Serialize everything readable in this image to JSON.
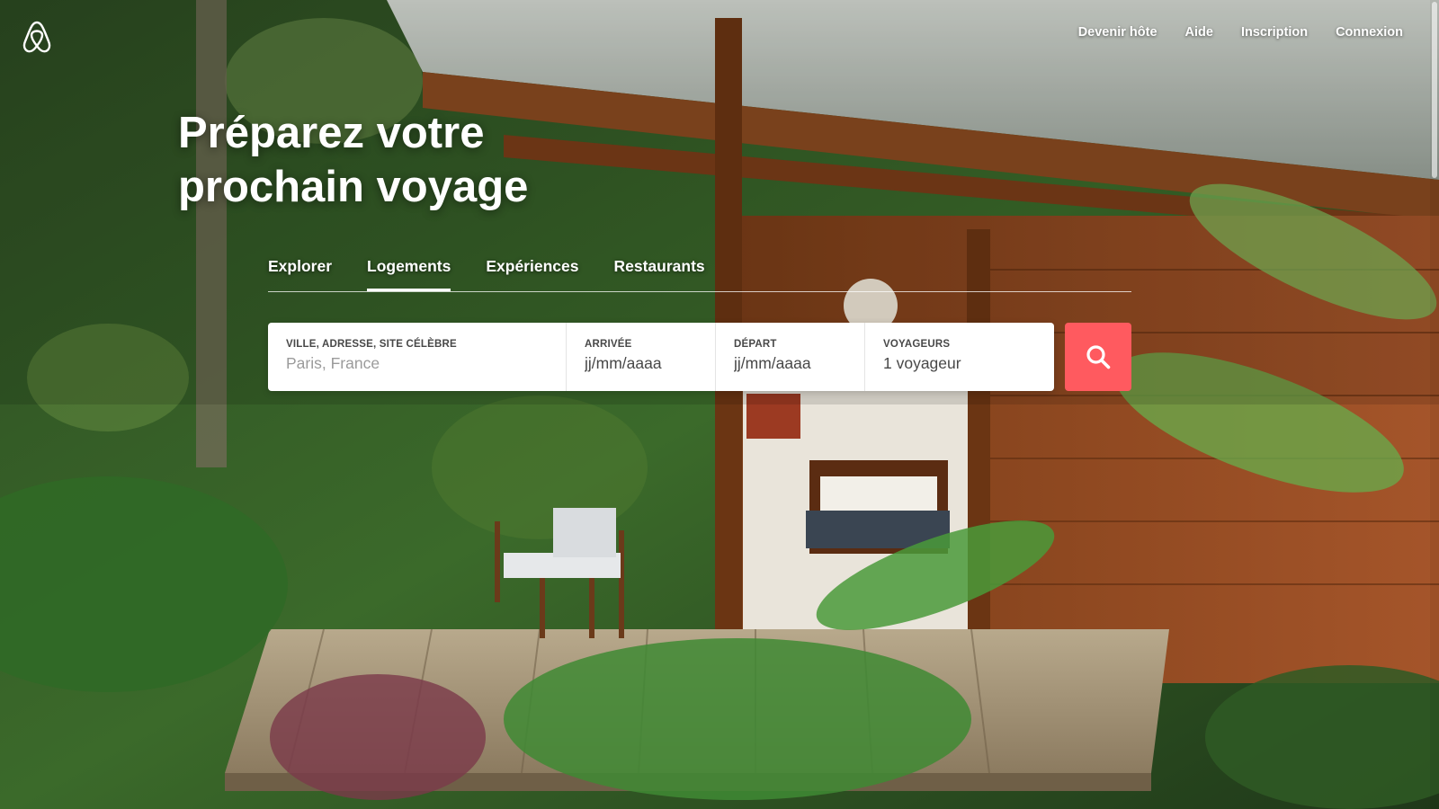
{
  "header": {
    "logo_icon": "airbnb-belo-logo-icon",
    "nav": [
      {
        "label": "Devenir hôte"
      },
      {
        "label": "Aide"
      },
      {
        "label": "Inscription"
      },
      {
        "label": "Connexion"
      }
    ]
  },
  "hero": {
    "title_line1": "Préparez votre",
    "title_line2": "prochain voyage"
  },
  "tabs": {
    "items": [
      {
        "label": "Explorer",
        "active": false
      },
      {
        "label": "Logements",
        "active": true
      },
      {
        "label": "Expériences",
        "active": false
      },
      {
        "label": "Restaurants",
        "active": false
      }
    ]
  },
  "search": {
    "where_label": "VILLE, ADRESSE, SITE CÉLÈBRE",
    "where_placeholder": "Paris, France",
    "checkin_label": "ARRIVÉE",
    "checkin_placeholder": "jj/mm/aaaa",
    "checkout_label": "DÉPART",
    "checkout_placeholder": "jj/mm/aaaa",
    "guests_label": "VOYAGEURS",
    "guests_value": "1 voyageur",
    "button_icon": "search-icon"
  },
  "colors": {
    "accent": "#ff5a5f",
    "text_dark": "#484848",
    "placeholder": "#9b9b9b",
    "white": "#ffffff"
  }
}
